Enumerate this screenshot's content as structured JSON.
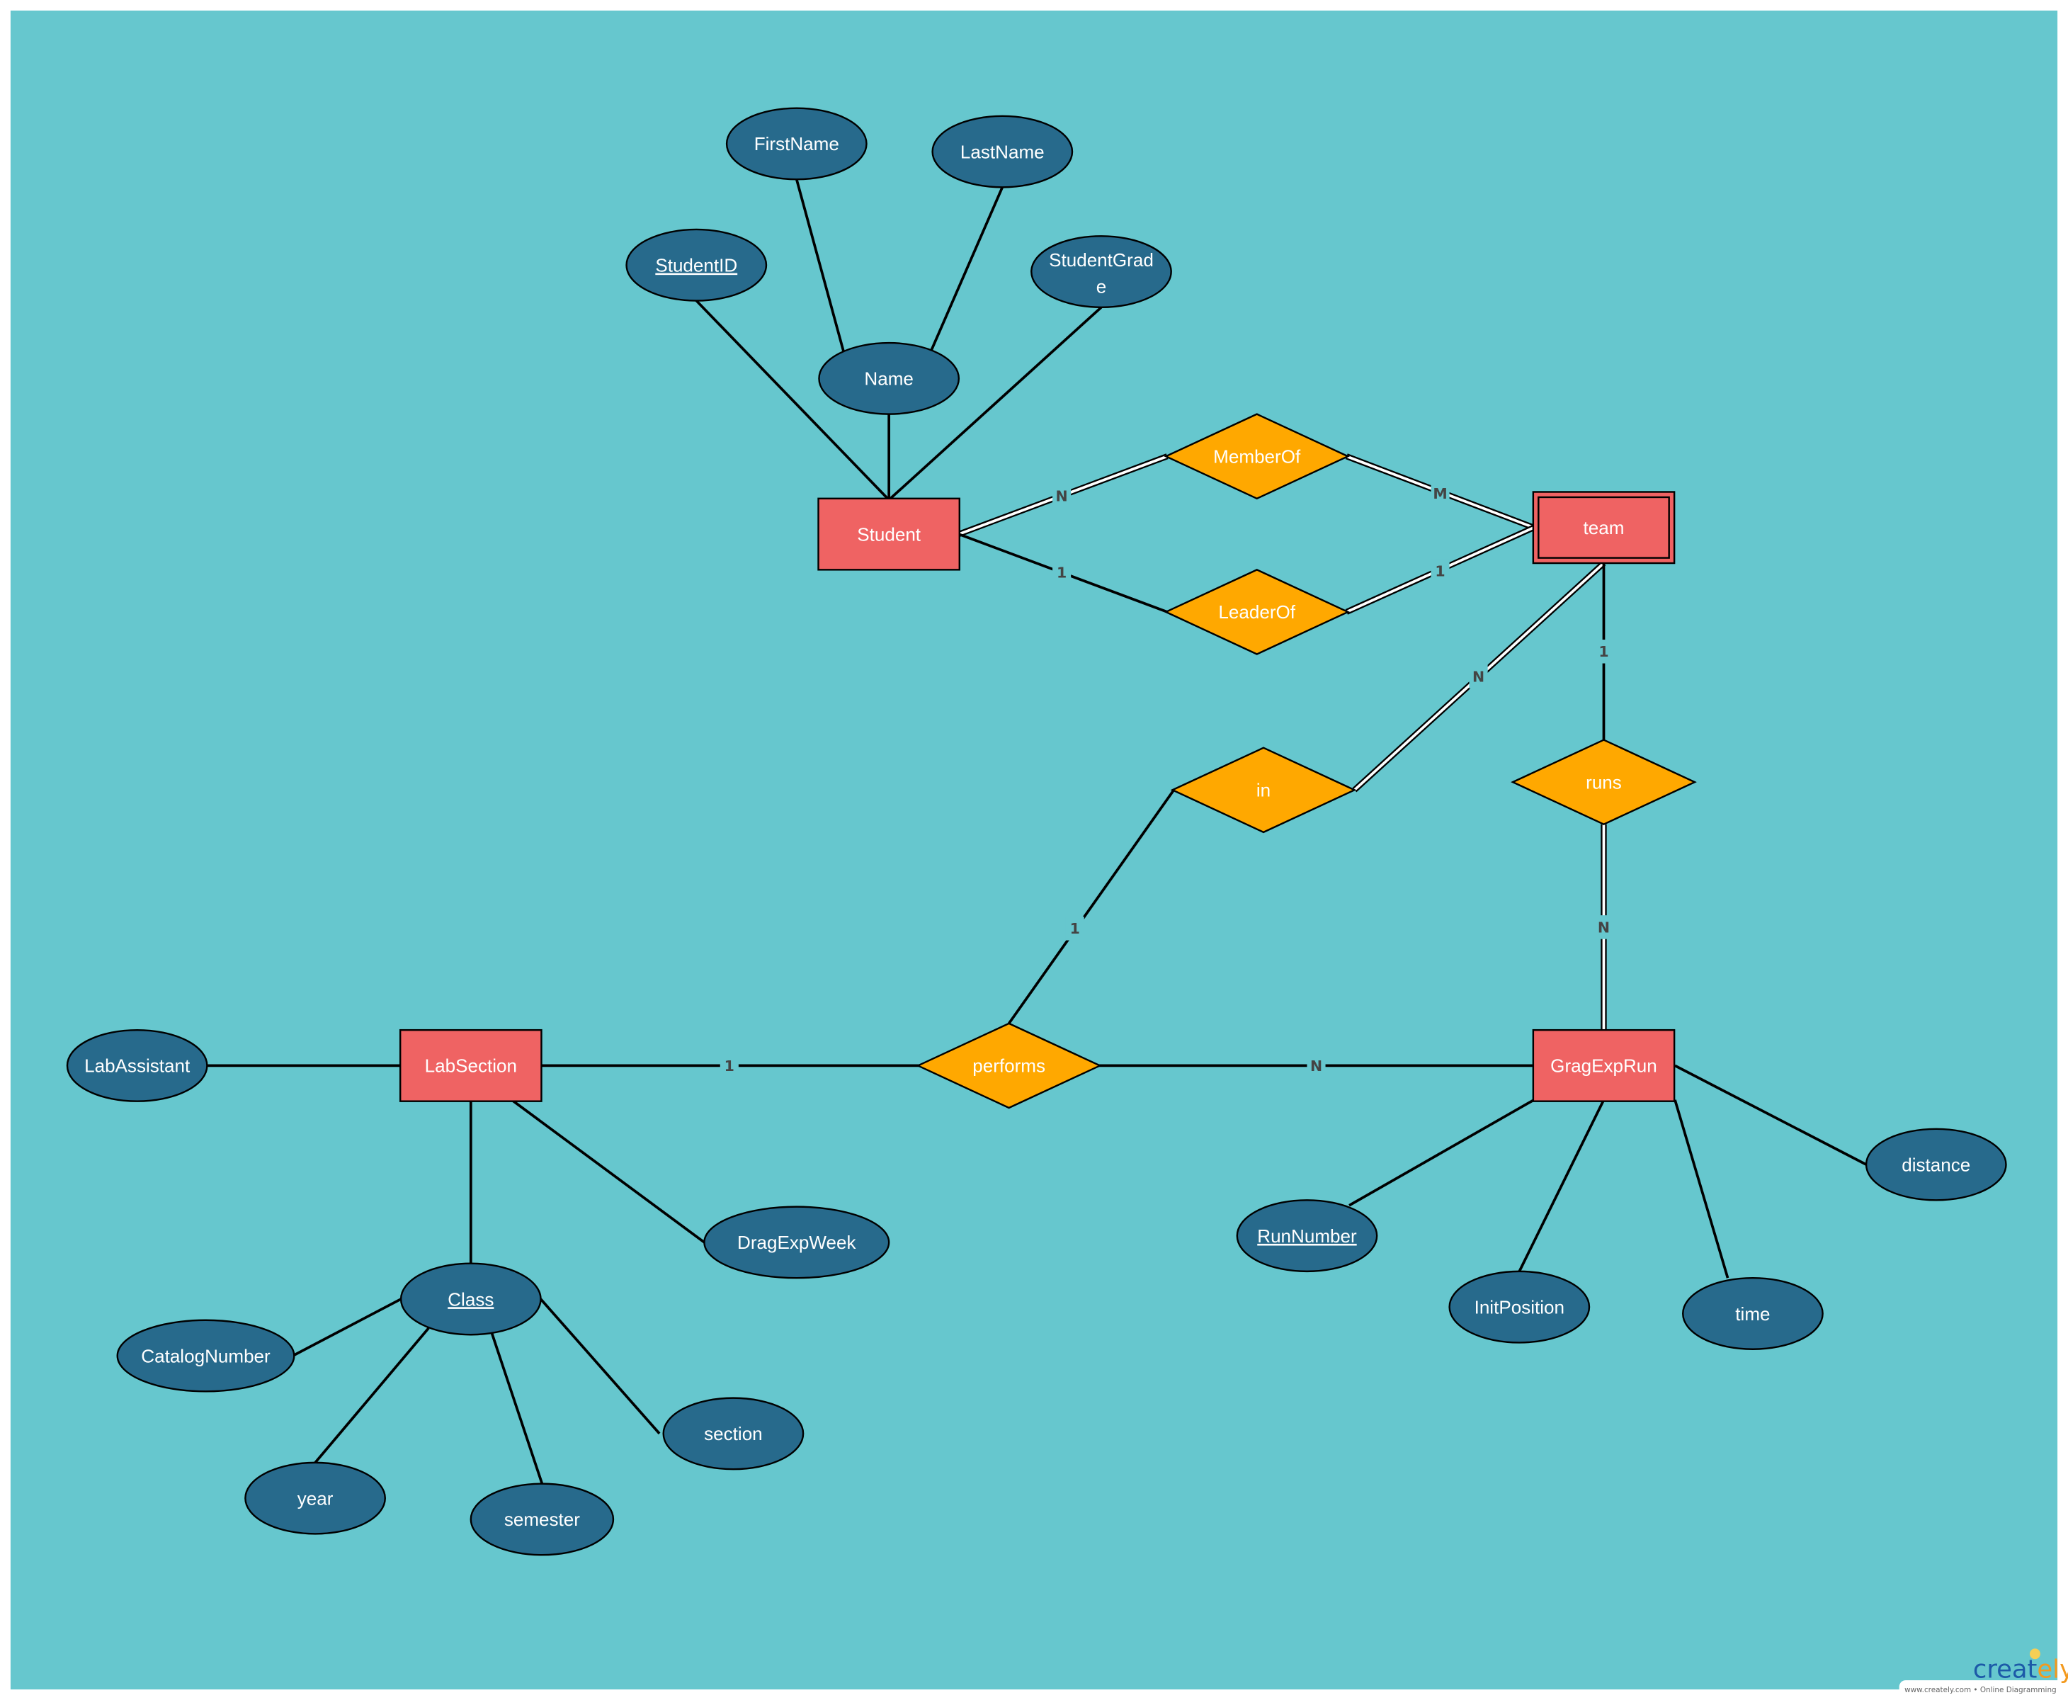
{
  "colors": {
    "background": "#66c7ce",
    "entity": "#ef6363",
    "relationship": "#ffa800",
    "attribute": "#276a8c",
    "text": "#ffffff",
    "cardinality": "#444444"
  },
  "entities": [
    {
      "id": "student",
      "label": "Student",
      "weak": false
    },
    {
      "id": "team",
      "label": "team",
      "weak": true
    },
    {
      "id": "labsection",
      "label": "LabSection",
      "weak": false
    },
    {
      "id": "gragexprun",
      "label": "GragExpRun",
      "weak": false
    }
  ],
  "relationships": [
    {
      "id": "memberof",
      "label": "MemberOf"
    },
    {
      "id": "leaderof",
      "label": "LeaderOf"
    },
    {
      "id": "in",
      "label": "in"
    },
    {
      "id": "runs",
      "label": "runs"
    },
    {
      "id": "performs",
      "label": "performs"
    }
  ],
  "attributes": [
    {
      "id": "studentid",
      "label": "StudentID",
      "key": true
    },
    {
      "id": "firstname",
      "label": "FirstName",
      "key": false
    },
    {
      "id": "lastname",
      "label": "LastName",
      "key": false
    },
    {
      "id": "studentgrade",
      "label": "StudentGrad",
      "label2": "e",
      "key": false
    },
    {
      "id": "name",
      "label": "Name",
      "key": false
    },
    {
      "id": "labassistant",
      "label": "LabAssistant",
      "key": false
    },
    {
      "id": "dragexpweek",
      "label": "DragExpWeek",
      "key": false
    },
    {
      "id": "class",
      "label": "Class",
      "key": true
    },
    {
      "id": "catalognumber",
      "label": "CatalogNumber",
      "key": false
    },
    {
      "id": "year",
      "label": "year",
      "key": false
    },
    {
      "id": "semester",
      "label": "semester",
      "key": false
    },
    {
      "id": "section",
      "label": "section",
      "key": false
    },
    {
      "id": "runnumber",
      "label": "RunNumber",
      "key": true
    },
    {
      "id": "initposition",
      "label": "InitPosition",
      "key": false
    },
    {
      "id": "time",
      "label": "time",
      "key": false
    },
    {
      "id": "distance",
      "label": "distance",
      "key": false
    }
  ],
  "connections": [
    {
      "from": "studentid",
      "to": "student",
      "cardinality": "",
      "double": false
    },
    {
      "from": "name",
      "to": "student",
      "cardinality": "",
      "double": false
    },
    {
      "from": "studentgrade",
      "to": "student",
      "cardinality": "",
      "double": false
    },
    {
      "from": "firstname",
      "to": "name",
      "cardinality": "",
      "double": false
    },
    {
      "from": "lastname",
      "to": "name",
      "cardinality": "",
      "double": false
    },
    {
      "from": "student",
      "to": "memberof",
      "cardinality": "N",
      "double": true
    },
    {
      "from": "memberof",
      "to": "team",
      "cardinality": "M",
      "double": true
    },
    {
      "from": "student",
      "to": "leaderof",
      "cardinality": "1",
      "double": false
    },
    {
      "from": "leaderof",
      "to": "team",
      "cardinality": "1",
      "double": true
    },
    {
      "from": "team",
      "to": "in",
      "cardinality": "N",
      "double": true
    },
    {
      "from": "team",
      "to": "runs",
      "cardinality": "1",
      "double": false
    },
    {
      "from": "runs",
      "to": "gragexprun",
      "cardinality": "N",
      "double": true
    },
    {
      "from": "in",
      "to": "performs",
      "cardinality": "1",
      "double": false
    },
    {
      "from": "labsection",
      "to": "performs",
      "cardinality": "1",
      "double": false
    },
    {
      "from": "performs",
      "to": "gragexprun",
      "cardinality": "N",
      "double": false
    },
    {
      "from": "labassistant",
      "to": "labsection",
      "cardinality": "",
      "double": false
    },
    {
      "from": "labsection",
      "to": "class",
      "cardinality": "",
      "double": false
    },
    {
      "from": "labsection",
      "to": "dragexpweek",
      "cardinality": "",
      "double": false
    },
    {
      "from": "class",
      "to": "catalognumber",
      "cardinality": "",
      "double": false
    },
    {
      "from": "class",
      "to": "year",
      "cardinality": "",
      "double": false
    },
    {
      "from": "class",
      "to": "semester",
      "cardinality": "",
      "double": false
    },
    {
      "from": "class",
      "to": "section",
      "cardinality": "",
      "double": false
    },
    {
      "from": "gragexprun",
      "to": "runnumber",
      "cardinality": "",
      "double": false
    },
    {
      "from": "gragexprun",
      "to": "initposition",
      "cardinality": "",
      "double": false
    },
    {
      "from": "gragexprun",
      "to": "time",
      "cardinality": "",
      "double": false
    },
    {
      "from": "gragexprun",
      "to": "distance",
      "cardinality": "",
      "double": false
    }
  ],
  "watermark": {
    "brand": "creately",
    "tagline": "www.creately.com • Online Diagramming"
  }
}
